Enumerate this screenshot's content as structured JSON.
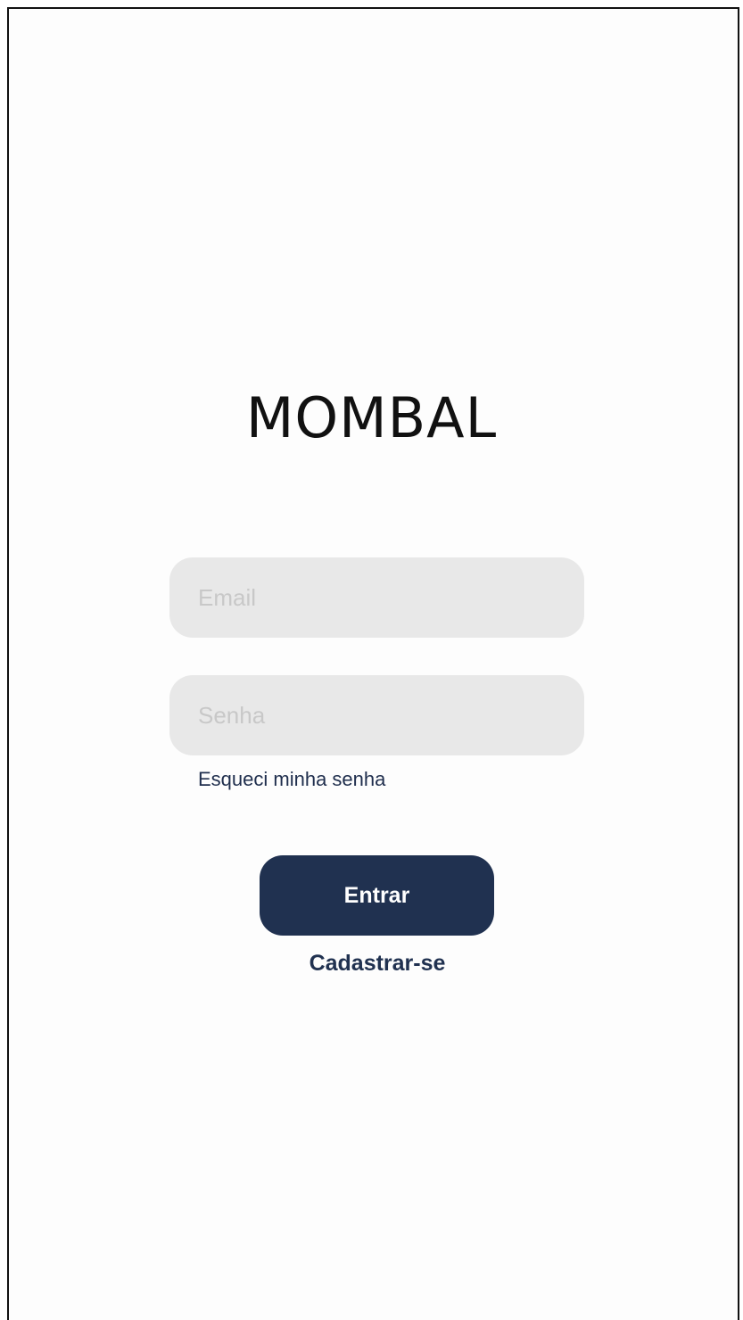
{
  "brand": {
    "logo_text": "MOMBAL"
  },
  "login_form": {
    "email_placeholder": "Email",
    "email_value": "",
    "password_placeholder": "Senha",
    "password_value": "",
    "forgot_password_label": "Esqueci minha senha",
    "submit_label": "Entrar",
    "signup_label": "Cadastrar-se"
  },
  "colors": {
    "primary": "#203150",
    "field_background": "#e8e8e8",
    "placeholder": "#c8c8c8",
    "background": "#ffffff"
  }
}
